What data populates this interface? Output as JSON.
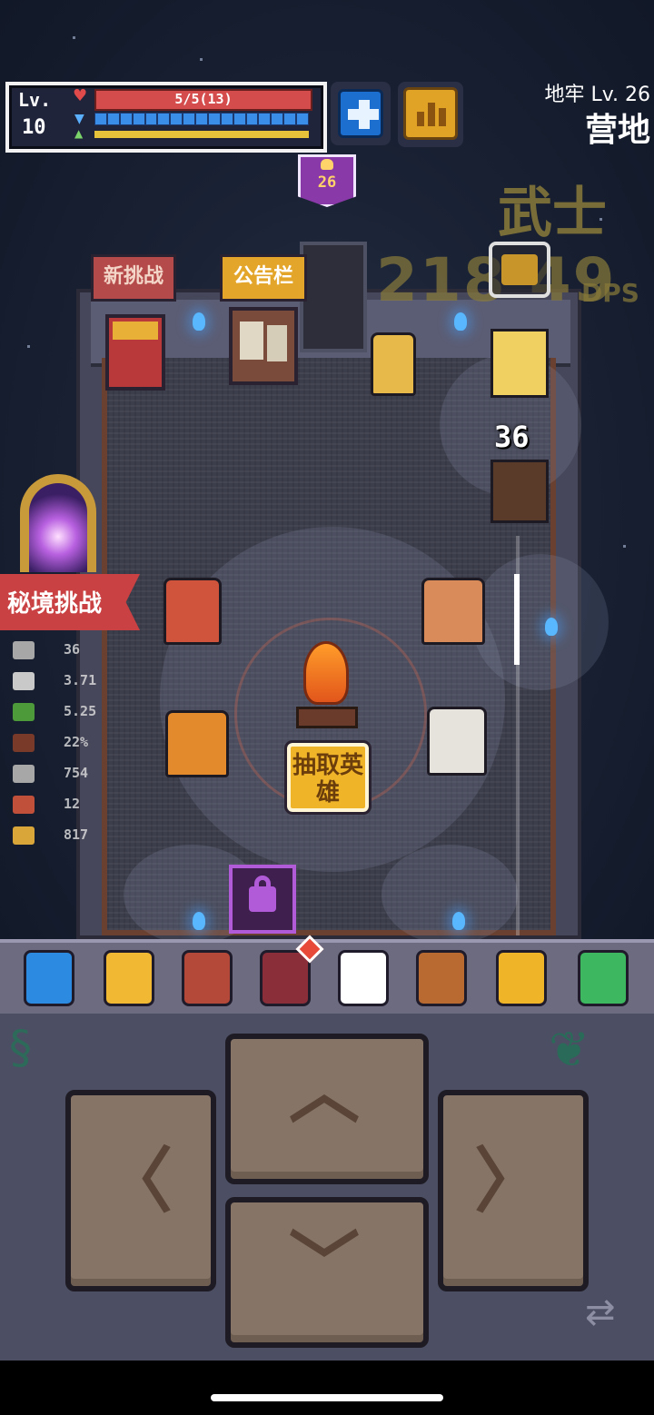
{
  "hud": {
    "lv_label": "Lv.",
    "level": "10",
    "hp_text": "5/5(13)",
    "mana_segments": 17
  },
  "location": {
    "dungeon_level": "地牢 Lv. 26",
    "area": "营地"
  },
  "hero": {
    "class_name": "武士",
    "dps_value": "218 49",
    "dps_unit": "DPS"
  },
  "floor_badge": "26",
  "signs": {
    "new_challenge": "新挑战",
    "bulletin_board": "公告栏"
  },
  "combat": {
    "damage_number": "36"
  },
  "center_button": {
    "label": "抽取英雄"
  },
  "secret_challenge": {
    "label": "秘境挑战"
  },
  "stats": [
    {
      "icon": "crossed-swords-icon",
      "value": "36",
      "color": "#a7a7a7"
    },
    {
      "icon": "sword-icon",
      "value": "3.71",
      "color": "#c9c9c9"
    },
    {
      "icon": "boot-icon",
      "value": "5.25",
      "color": "#4d9a3a"
    },
    {
      "icon": "shield-icon",
      "value": "22%",
      "color": "#7a3a2a"
    },
    {
      "icon": "health-potion-icon",
      "value": "754",
      "color": "#a7a7a7"
    },
    {
      "icon": "mana-potion-icon",
      "value": "12",
      "color": "#c0503a"
    },
    {
      "icon": "gold-icon",
      "value": "817",
      "color": "#d9a63a"
    }
  ],
  "toolbar": [
    {
      "name": "hero-figure-icon",
      "color": "#2c8ae0"
    },
    {
      "name": "sparkle-icon",
      "color": "#f1b834"
    },
    {
      "name": "spellbook-icon",
      "color": "#b4493a"
    },
    {
      "name": "backpack-icon",
      "color": "#8a2e3a"
    },
    {
      "name": "auto-target-icon",
      "color": "#ffffff"
    },
    {
      "name": "magnifier-icon",
      "color": "#b86a30"
    },
    {
      "name": "pause-icon",
      "color": "#f0b429"
    },
    {
      "name": "collapse-arrow-icon",
      "color": "#3db860"
    }
  ],
  "controls": {
    "up": "up-arrow-icon",
    "down": "down-arrow-icon",
    "left": "left-arrow-icon",
    "right": "right-arrow-icon"
  }
}
